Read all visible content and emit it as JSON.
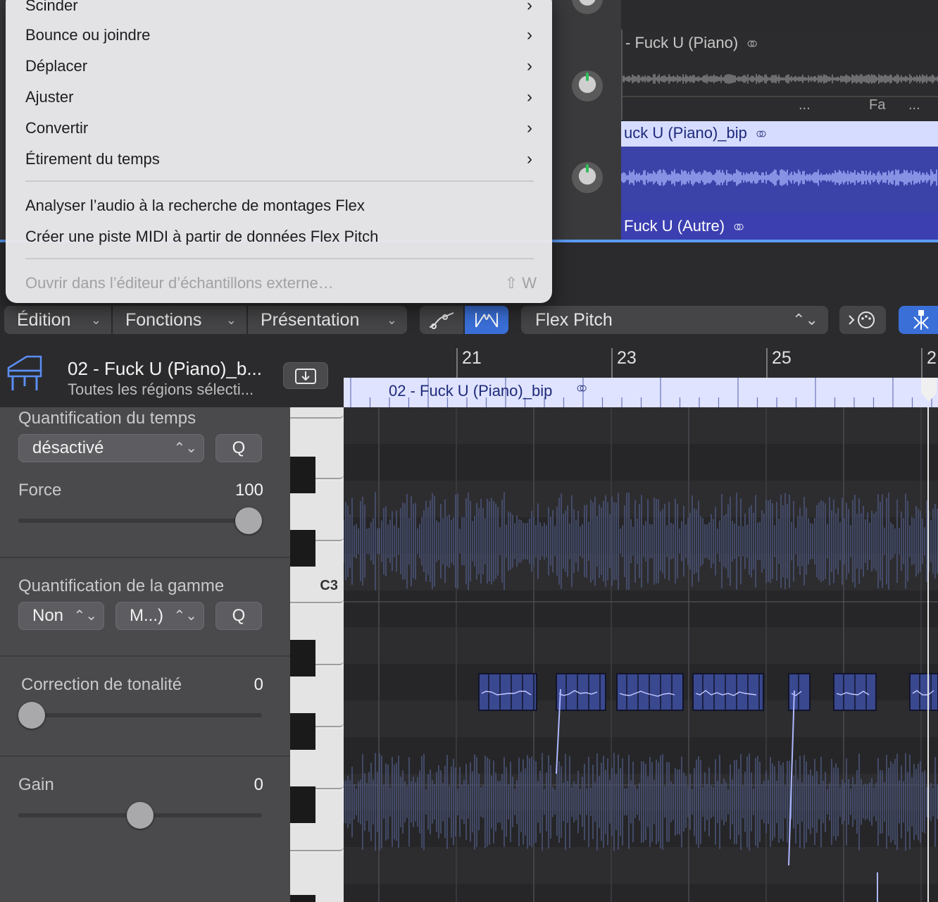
{
  "context_menu": {
    "items": [
      {
        "label": "Scinder",
        "submenu": true
      },
      {
        "label": "Bounce ou joindre",
        "submenu": true
      },
      {
        "label": "Déplacer",
        "submenu": true
      },
      {
        "label": "Ajuster",
        "submenu": true
      },
      {
        "label": "Convertir",
        "submenu": true
      },
      {
        "label": "Étirement du temps",
        "submenu": true
      }
    ],
    "actions": [
      {
        "label": "Analyser l’audio à la recherche de montages Flex"
      },
      {
        "label": "Créer une piste MIDI à partir de données Flex Pitch"
      }
    ],
    "disabled_item": {
      "label": "Ouvrir dans l’éditeur d’échantillons externe…",
      "shortcut": "⇧ W"
    }
  },
  "tracks": {
    "regions": [
      {
        "name": "- Fuck U (Piano)",
        "color": "#2b2b2d"
      },
      {
        "name": "uck U (Piano)_bip",
        "color": "#d6dcff"
      },
      {
        "name": "Fuck U (Autre)",
        "color": "#3b3fb0"
      }
    ],
    "subtexts": [
      "...",
      "Fa",
      "..."
    ]
  },
  "toolbar": {
    "menus": [
      "Édition",
      "Fonctions",
      "Présentation"
    ],
    "flex_mode": "Flex Pitch"
  },
  "inspector": {
    "title": "02 - Fuck U (Piano)_b...",
    "subtitle": "Toutes les régions sélecti...",
    "time_quantize": {
      "label": "Quantification du temps",
      "value": "désactivé",
      "q": "Q"
    },
    "strength": {
      "label": "Force",
      "value": "100",
      "level": 1.0
    },
    "scale_quantize": {
      "label": "Quantification de la gamme",
      "root": "Non",
      "mode": "M...)",
      "q": "Q"
    },
    "pitch_correction": {
      "label": "Correction de tonalité",
      "value": "0",
      "level": 0.0
    },
    "gain": {
      "label": "Gain",
      "value": "0",
      "level": 0.5
    }
  },
  "editor": {
    "ruler": [
      "21",
      "23",
      "25",
      "2"
    ],
    "region_name": "02 - Fuck U (Piano)_bip",
    "key_label": "C3"
  },
  "colors": {
    "accent": "#3a6fd8",
    "region_light": "#dfe3ff",
    "note": "#3a4890"
  }
}
